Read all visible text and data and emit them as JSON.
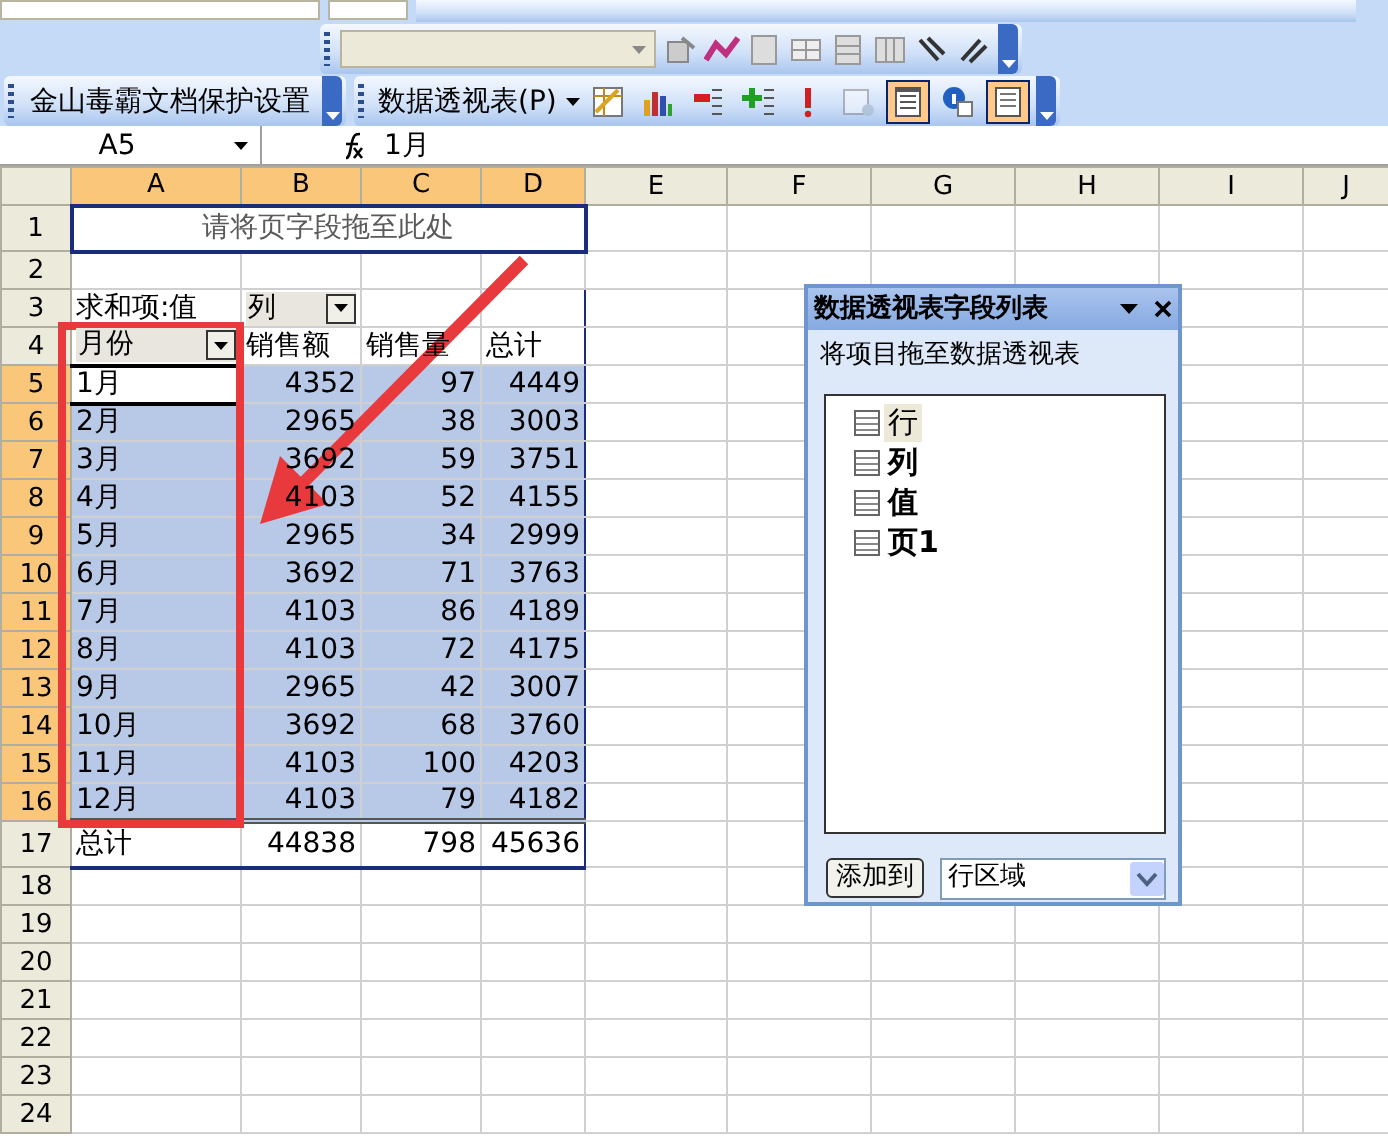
{
  "toolbars": {
    "formatting": {
      "font_field": {
        "disabled": false
      },
      "size_field": {
        "disabled": false
      }
    },
    "chart": {
      "dropdown": {
        "disabled": true
      }
    },
    "kingsoft": {
      "label": "金山毒霸文档保护设置"
    },
    "pivot": {
      "menu": "数据透视表(P)",
      "buttons": [
        {
          "kind": "format",
          "pressed": false,
          "disabled": false
        },
        {
          "kind": "chart",
          "pressed": false,
          "disabled": false
        },
        {
          "kind": "hide",
          "pressed": false,
          "disabled": false
        },
        {
          "kind": "show",
          "pressed": false,
          "disabled": false
        },
        {
          "kind": "refresh",
          "pressed": false,
          "disabled": false
        },
        {
          "kind": "settings",
          "pressed": false,
          "disabled": true
        },
        {
          "kind": "fieldlist",
          "pressed": true,
          "disabled": false
        },
        {
          "kind": "info",
          "pressed": false,
          "disabled": false
        },
        {
          "kind": "page",
          "pressed": true,
          "disabled": false
        }
      ]
    }
  },
  "name_box": "A5",
  "formula": "1月",
  "sheet": {
    "columns": [
      {
        "label": "A",
        "selected": true
      },
      {
        "label": "B",
        "selected": true
      },
      {
        "label": "C",
        "selected": true
      },
      {
        "label": "D",
        "selected": true
      },
      {
        "label": "E",
        "selected": false
      },
      {
        "label": "F",
        "selected": false
      },
      {
        "label": "G",
        "selected": false
      },
      {
        "label": "H",
        "selected": false
      },
      {
        "label": "I",
        "selected": false
      },
      {
        "label": "J",
        "selected": false
      }
    ],
    "rows": [
      {
        "number": "1",
        "selected": false,
        "kind": "page_drop",
        "text": "请将页字段拖至此处"
      },
      {
        "number": "2",
        "selected": false,
        "kind": "empty"
      },
      {
        "number": "3",
        "selected": false,
        "kind": "data_header",
        "label": "求和项:值",
        "field": "列"
      },
      {
        "number": "4",
        "selected": false,
        "kind": "field_header",
        "cells": [
          "月份",
          "销售额",
          "销售量",
          "总计"
        ]
      },
      {
        "number": "5",
        "selected": true,
        "active": true,
        "kind": "data",
        "cells": [
          "1月",
          "4352",
          "97",
          "4449"
        ]
      },
      {
        "number": "6",
        "selected": true,
        "active": false,
        "kind": "data",
        "cells": [
          "2月",
          "2965",
          "38",
          "3003"
        ]
      },
      {
        "number": "7",
        "selected": true,
        "active": false,
        "kind": "data",
        "cells": [
          "3月",
          "3692",
          "59",
          "3751"
        ]
      },
      {
        "number": "8",
        "selected": true,
        "active": false,
        "kind": "data",
        "cells": [
          "4月",
          "4103",
          "52",
          "4155"
        ]
      },
      {
        "number": "9",
        "selected": true,
        "active": false,
        "kind": "data",
        "cells": [
          "5月",
          "2965",
          "34",
          "2999"
        ]
      },
      {
        "number": "10",
        "selected": true,
        "active": false,
        "kind": "data",
        "cells": [
          "6月",
          "3692",
          "71",
          "3763"
        ]
      },
      {
        "number": "11",
        "selected": true,
        "active": false,
        "kind": "data",
        "cells": [
          "7月",
          "4103",
          "86",
          "4189"
        ]
      },
      {
        "number": "12",
        "selected": true,
        "active": false,
        "kind": "data",
        "cells": [
          "8月",
          "4103",
          "72",
          "4175"
        ]
      },
      {
        "number": "13",
        "selected": true,
        "active": false,
        "kind": "data",
        "cells": [
          "9月",
          "2965",
          "42",
          "3007"
        ]
      },
      {
        "number": "14",
        "selected": true,
        "active": false,
        "kind": "data",
        "cells": [
          "10月",
          "3692",
          "68",
          "3760"
        ]
      },
      {
        "number": "15",
        "selected": true,
        "active": false,
        "kind": "data",
        "cells": [
          "11月",
          "4103",
          "100",
          "4203"
        ]
      },
      {
        "number": "16",
        "selected": true,
        "active": false,
        "kind": "data",
        "cells": [
          "12月",
          "4103",
          "79",
          "4182"
        ]
      },
      {
        "number": "17",
        "selected": false,
        "kind": "total",
        "cells": [
          "总计",
          "44838",
          "798",
          "45636"
        ]
      },
      {
        "number": "18",
        "selected": false,
        "kind": "empty"
      },
      {
        "number": "19",
        "selected": false,
        "kind": "empty"
      },
      {
        "number": "20",
        "selected": false,
        "kind": "empty"
      },
      {
        "number": "21",
        "selected": false,
        "kind": "empty"
      },
      {
        "number": "22",
        "selected": false,
        "kind": "empty"
      },
      {
        "number": "23",
        "selected": false,
        "kind": "empty"
      },
      {
        "number": "24",
        "selected": false,
        "kind": "empty"
      }
    ]
  },
  "field_list": {
    "title": "数据透视表字段列表",
    "hint": "将项目拖至数据透视表",
    "items": [
      {
        "label": "行",
        "in_use": false,
        "selected": true
      },
      {
        "label": "列",
        "in_use": true,
        "selected": false
      },
      {
        "label": "值",
        "in_use": true,
        "selected": false
      },
      {
        "label": "页1",
        "in_use": true,
        "selected": false
      }
    ],
    "add_button": "添加到",
    "area": "行区域"
  }
}
